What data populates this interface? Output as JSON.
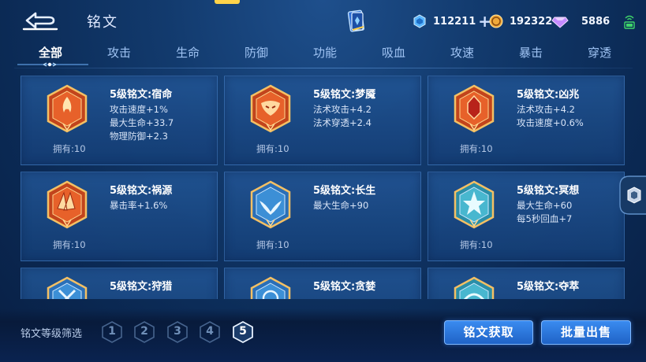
{
  "header": {
    "title": "铭文",
    "diamond_value": "112211",
    "diamond_plus": "+",
    "gold_value": "192322",
    "gem_value": "5886",
    "colors": {
      "accent": "#ffd34a",
      "button": "#2b78de"
    }
  },
  "tabs": [
    {
      "label": "全部",
      "active": true
    },
    {
      "label": "攻击"
    },
    {
      "label": "生命"
    },
    {
      "label": "防御"
    },
    {
      "label": "功能"
    },
    {
      "label": "吸血"
    },
    {
      "label": "攻速"
    },
    {
      "label": "暴击"
    },
    {
      "label": "穿透"
    }
  ],
  "cards": [
    {
      "name": "5级铭文:宿命",
      "stats": [
        "攻击速度+1%",
        "最大生命+33.7",
        "物理防御+2.3"
      ],
      "owned": "拥有:10",
      "emblem_color": "red"
    },
    {
      "name": "5级铭文:梦魇",
      "stats": [
        "法术攻击+4.2",
        "法术穿透+2.4"
      ],
      "owned": "拥有:10",
      "emblem_color": "red"
    },
    {
      "name": "5级铭文:凶兆",
      "stats": [
        "法术攻击+4.2",
        "攻击速度+0.6%"
      ],
      "owned": "拥有:10",
      "emblem_color": "red"
    },
    {
      "name": "5级铭文:祸源",
      "stats": [
        "暴击率+1.6%"
      ],
      "owned": "拥有:10",
      "emblem_color": "red"
    },
    {
      "name": "5级铭文:长生",
      "stats": [
        "最大生命+90"
      ],
      "owned": "拥有:10",
      "emblem_color": "blue"
    },
    {
      "name": "5级铭文:冥想",
      "stats": [
        "最大生命+60",
        "每5秒回血+7"
      ],
      "owned": "拥有:10",
      "emblem_color": "blue"
    },
    {
      "name": "5级铭文:狩猎",
      "stats": [],
      "owned": "",
      "emblem_color": "blue"
    },
    {
      "name": "5级铭文:贪婪",
      "stats": [],
      "owned": "",
      "emblem_color": "blue"
    },
    {
      "name": "5级铭文:夺萃",
      "stats": [],
      "owned": "",
      "emblem_color": "blue"
    }
  ],
  "footer": {
    "filter_label": "铭文等级筛选",
    "levels": [
      "1",
      "2",
      "3",
      "4",
      "5"
    ],
    "selected_level": "5",
    "get_button": "铭文获取",
    "sell_button": "批量出售"
  }
}
